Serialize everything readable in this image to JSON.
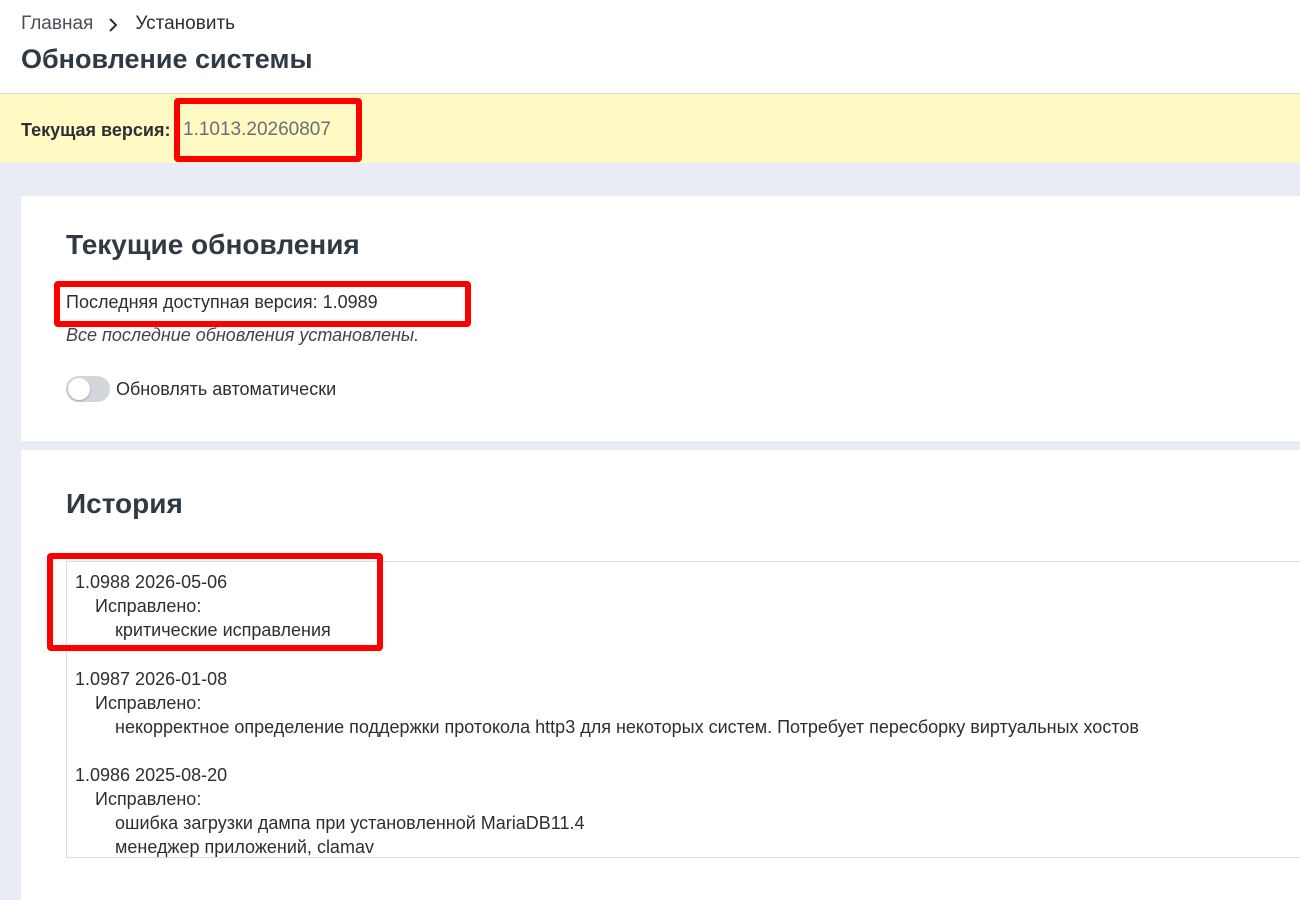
{
  "breadcrumb": {
    "home": "Главная",
    "current": "Установить"
  },
  "page_title": "Обновление системы",
  "version_banner": {
    "label": "Текущая версия:",
    "value": "1.1013.20260807"
  },
  "updates": {
    "title": "Текущие обновления",
    "latest_version": "Последняя доступная версия: 1.0989",
    "status": "Все последние обновления установлены.",
    "auto_update_label": "Обновлять автоматически",
    "auto_update_enabled": false
  },
  "history": {
    "title": "История",
    "entries": [
      {
        "header": "1.0988 2026-05-06",
        "section": "Исправлено:",
        "items": [
          "критические исправления"
        ]
      },
      {
        "header": "1.0987 2026-01-08",
        "section": "Исправлено:",
        "items": [
          "некорректное определение поддержки протокола http3 для некоторых систем. Потребует пересборку виртуальных хостов"
        ]
      },
      {
        "header": "1.0986 2025-08-20",
        "section": "Исправлено:",
        "items": [
          "ошибка загрузки дампа при установленной MariaDB11.4",
          "менеджер приложений, clamav"
        ]
      }
    ]
  },
  "colors": {
    "banner_bg": "#fff9c4",
    "backdrop": "#e8ecf4",
    "highlight": "#ff0000",
    "toggle_off": "#d3d6da"
  }
}
